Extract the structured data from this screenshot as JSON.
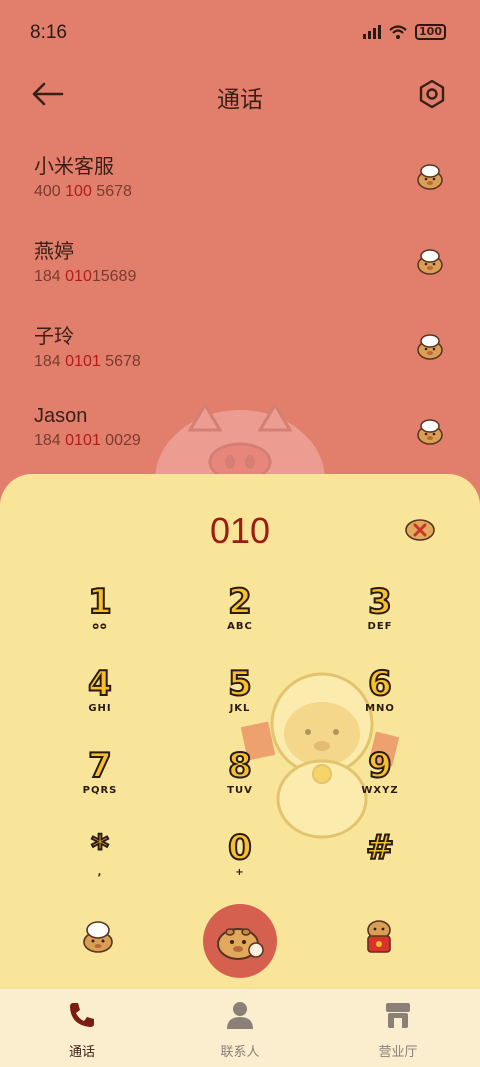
{
  "status": {
    "time": "8:16",
    "battery": "100"
  },
  "header": {
    "title": "通话"
  },
  "contacts": [
    {
      "name": "小米客服",
      "pre": "400 ",
      "hl": "100",
      "post": " 5678"
    },
    {
      "name": "燕婷",
      "pre": "184 ",
      "hl": "010",
      "post": "15689"
    },
    {
      "name": "子玲",
      "pre": "184 ",
      "hl": "0101",
      "post": " 5678"
    },
    {
      "name": "Jason",
      "pre": "184 ",
      "hl": "0101",
      "post": " 0029"
    }
  ],
  "dialer": {
    "number": "010",
    "keys": [
      {
        "digit": "1",
        "sub": "ᴑᴑ"
      },
      {
        "digit": "2",
        "sub": "ABC"
      },
      {
        "digit": "3",
        "sub": "DEF"
      },
      {
        "digit": "4",
        "sub": "GHI"
      },
      {
        "digit": "5",
        "sub": "JKL"
      },
      {
        "digit": "6",
        "sub": "MNO"
      },
      {
        "digit": "7",
        "sub": "PQRS"
      },
      {
        "digit": "8",
        "sub": "TUV"
      },
      {
        "digit": "9",
        "sub": "WXYZ"
      },
      {
        "digit": "*",
        "sub": ","
      },
      {
        "digit": "0",
        "sub": "+"
      },
      {
        "digit": "#",
        "sub": ""
      }
    ]
  },
  "nav": {
    "items": [
      {
        "label": "通话",
        "active": true
      },
      {
        "label": "联系人",
        "active": false
      },
      {
        "label": "营业厅",
        "active": false
      }
    ]
  },
  "colors": {
    "accent": "#9b1c13",
    "panel": "#f9e59a",
    "background": "#e17f6c",
    "call": "#d6604f"
  }
}
